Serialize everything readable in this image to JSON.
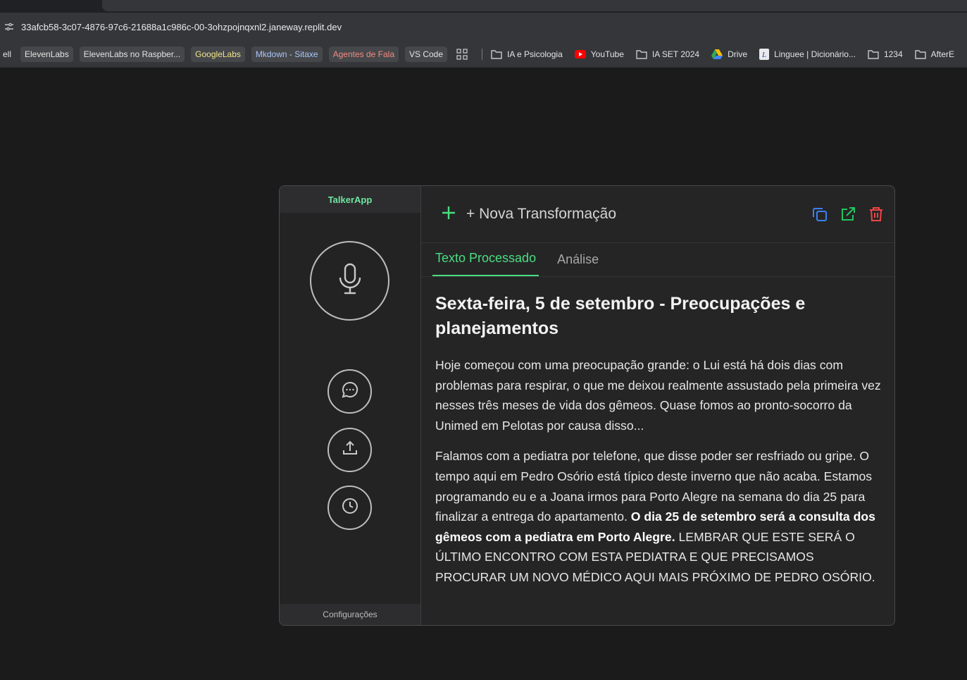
{
  "browser": {
    "url": "33afcb58-3c07-4876-97c6-21688a1c986c-00-3ohzpojnqxnl2.janeway.replit.dev",
    "bookmarks": [
      {
        "label": "ell",
        "style": "plain",
        "icon": "none"
      },
      {
        "label": "ElevenLabs",
        "style": "chip",
        "icon": "none"
      },
      {
        "label": "ElevenLabs no Raspber...",
        "style": "chip",
        "icon": "none"
      },
      {
        "label": "GoogleLabs",
        "style": "chip",
        "icon": "none",
        "color": "#f0e68c"
      },
      {
        "label": "Mkdown - Sitaxe",
        "style": "chip",
        "icon": "none",
        "color": "#a8c7fa"
      },
      {
        "label": "Agentes de Fala",
        "style": "chip",
        "icon": "none",
        "color": "#f28b82"
      },
      {
        "label": "VS Code",
        "style": "chip",
        "icon": "none"
      },
      {
        "label": "",
        "style": "plain",
        "icon": "apps-grid-icon"
      },
      {
        "label": "IA e Psicologia",
        "style": "plain",
        "icon": "folder-icon"
      },
      {
        "label": "YouTube",
        "style": "plain",
        "icon": "youtube-icon"
      },
      {
        "label": "IA SET 2024",
        "style": "plain",
        "icon": "folder-icon"
      },
      {
        "label": "Drive",
        "style": "plain",
        "icon": "drive-icon"
      },
      {
        "label": "Linguee | Dicionário...",
        "style": "plain",
        "icon": "linguee-icon"
      },
      {
        "label": "1234",
        "style": "plain",
        "icon": "folder-icon"
      },
      {
        "label": "AfterE",
        "style": "plain",
        "icon": "folder-icon"
      }
    ]
  },
  "app": {
    "brand": "TalkerApp",
    "settings_label": "Configurações",
    "new_transformation_label": "+ Nova Transformação",
    "tabs": [
      {
        "label": "Texto Processado",
        "active": true
      },
      {
        "label": "Análise",
        "active": false
      }
    ],
    "document": {
      "title": "Sexta-feira, 5 de setembro - Preocupações e planejamentos",
      "paragraph1": "Hoje começou com uma preocupação grande: o Lui está há dois dias com problemas para respirar, o que me deixou realmente assustado pela primeira vez nesses três meses de vida dos gêmeos. Quase fomos ao pronto-socorro da Unimed em Pelotas por causa disso...",
      "paragraph2_start": "Falamos com a pediatra por telefone, que disse poder ser resfriado ou gripe. O tempo aqui em Pedro Osório está típico deste inverno que não acaba. Estamos programando eu e a Joana irmos para Porto Alegre na semana do dia 25 para finalizar a entrega do apartamento. ",
      "paragraph2_bold": "O dia 25 de setembro será a consulta dos gêmeos com a pediatra em Porto Alegre.",
      "paragraph2_end": " LEMBRAR QUE ESTE SERÁ O ÚLTIMO ENCONTRO COM ESTA PEDIATRA E QUE PRECISAMOS PROCURAR UM NOVO MÉDICO AQUI MAIS PRÓXIMO DE PEDRO OSÓRIO."
    },
    "colors": {
      "accent": "#4ade80",
      "copy_icon": "#3b82f6",
      "open_icon": "#22c55e",
      "delete_icon": "#ef4444"
    }
  }
}
